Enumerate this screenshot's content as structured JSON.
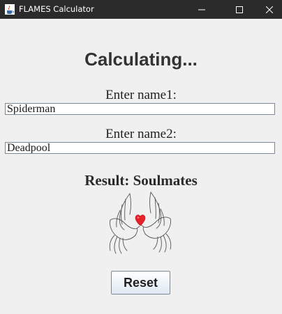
{
  "window": {
    "title": "FLAMES Calculator",
    "icon": "java-cup-icon",
    "controls": [
      "minimize",
      "maximize",
      "close"
    ]
  },
  "main": {
    "heading": "Calculating...",
    "name1_label": "Enter name1:",
    "name1_value": "Spiderman",
    "name2_label": "Enter name2:",
    "name2_value": "Deadpool",
    "result_text": "Result: Soulmates",
    "result_image": "doves-heart-icon",
    "reset_label": "Reset"
  },
  "colors": {
    "titlebar": "#2b2b2b",
    "background": "#f0f0f0",
    "heart": "#e8202a"
  }
}
